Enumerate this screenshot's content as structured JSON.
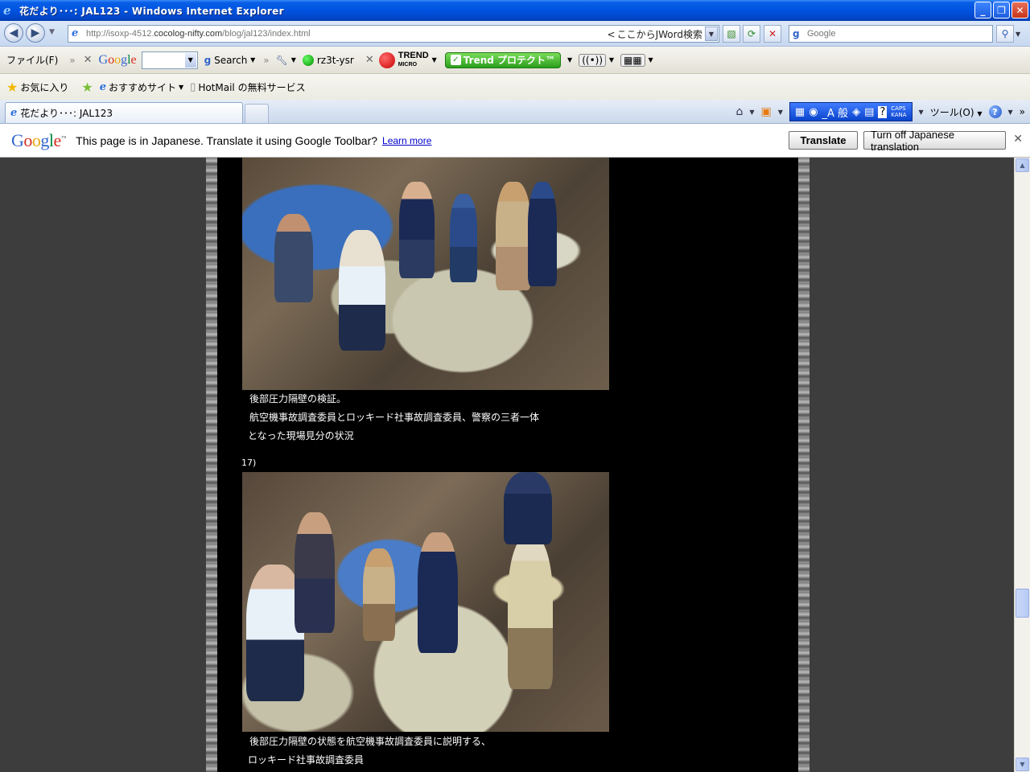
{
  "window": {
    "title": "花だより･･･: JAL123 - Windows Internet Explorer"
  },
  "address": {
    "url_prefix": "http://isoxp-4512.",
    "url_domain": "cocolog-nifty.com",
    "url_path": "/blog/jal123/index.html",
    "jword": "ここからJWord検索",
    "search_placeholder": "Google"
  },
  "toolbar": {
    "file_menu": "ファイル(F)",
    "search_label": "Search",
    "rz_label": "rz3t-ysr",
    "trend_line1": "TREND",
    "trend_line2": "MICRO",
    "trend_protect": "Trend プロテクト™"
  },
  "favorites": {
    "favorites_label": "お気に入り",
    "recommended": "おすすめサイト",
    "hotmail": "HotMail の無料サービス"
  },
  "tabs": [
    {
      "label": "花だより･･･: JAL123"
    }
  ],
  "cmdbar": {
    "ime_text": "_A 般",
    "caps": "CAPS",
    "kana": "KANA",
    "tools": "ツール(O)"
  },
  "translate_bar": {
    "logo": "Google",
    "message": "This page is in Japanese.  Translate it using Google Toolbar?",
    "learn_more": "Learn more",
    "translate_button": "Translate",
    "turn_off_button": "Turn off Japanese translation"
  },
  "content": {
    "caption1_line1": "後部圧力隔壁の検証。",
    "caption1_line2": "航空機事故調査委員とロッキード社事故調査委員、警察の三者一体",
    "caption1_line3": "となった現場見分の状況",
    "item_number": "17)",
    "caption2_line1": "後部圧力隔壁の状態を航空機事故調査委員に説明する、",
    "caption2_line2": "ロッキード社事故調査委員"
  }
}
